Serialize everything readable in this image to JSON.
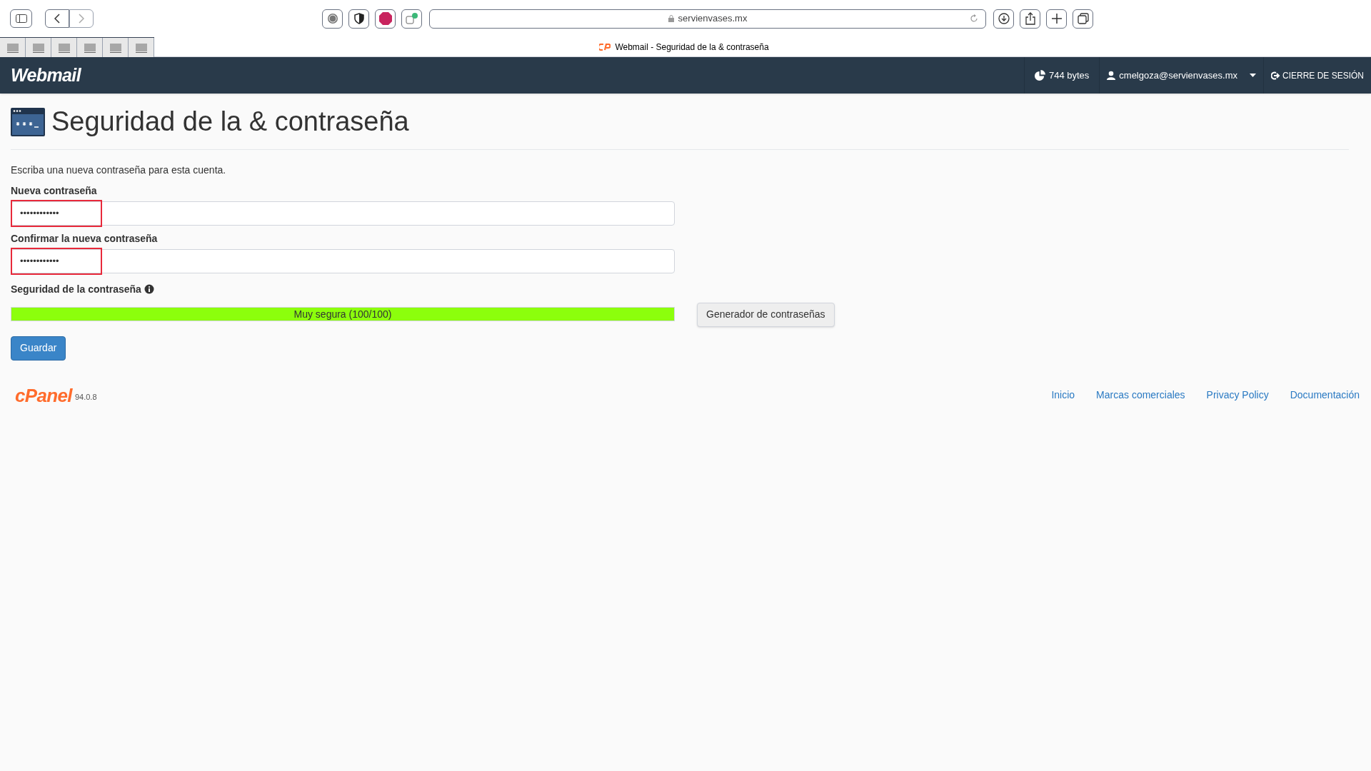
{
  "browser": {
    "address": "servienvases.mx",
    "tab_title": "Webmail - Seguridad de la & contraseña"
  },
  "header": {
    "logo": "Webmail",
    "disk_usage": "744 bytes",
    "user": "cmelgoza@servienvases.mx",
    "logout": "CIERRE DE SESIÓN"
  },
  "page": {
    "title": "Seguridad de la & contraseña",
    "description": "Escriba una nueva contraseña para esta cuenta.",
    "fields": [
      {
        "label": "Nueva contraseña",
        "value": "••••••••••••",
        "highlighted": true
      },
      {
        "label": "Confirmar la nueva contraseña",
        "value": "••••••••••••",
        "highlighted": true
      }
    ],
    "strength": {
      "label": "Seguridad de la contraseña",
      "reading": "Muy segura (100/100)",
      "level": 1.0
    },
    "generator_button": "Generador de contraseñas",
    "save_button": "Guardar"
  },
  "footer": {
    "logo": "cPanel",
    "version": "94.0.8",
    "links": [
      "Inicio",
      "Marcas comerciales",
      "Privacy Policy",
      "Documentación"
    ]
  }
}
